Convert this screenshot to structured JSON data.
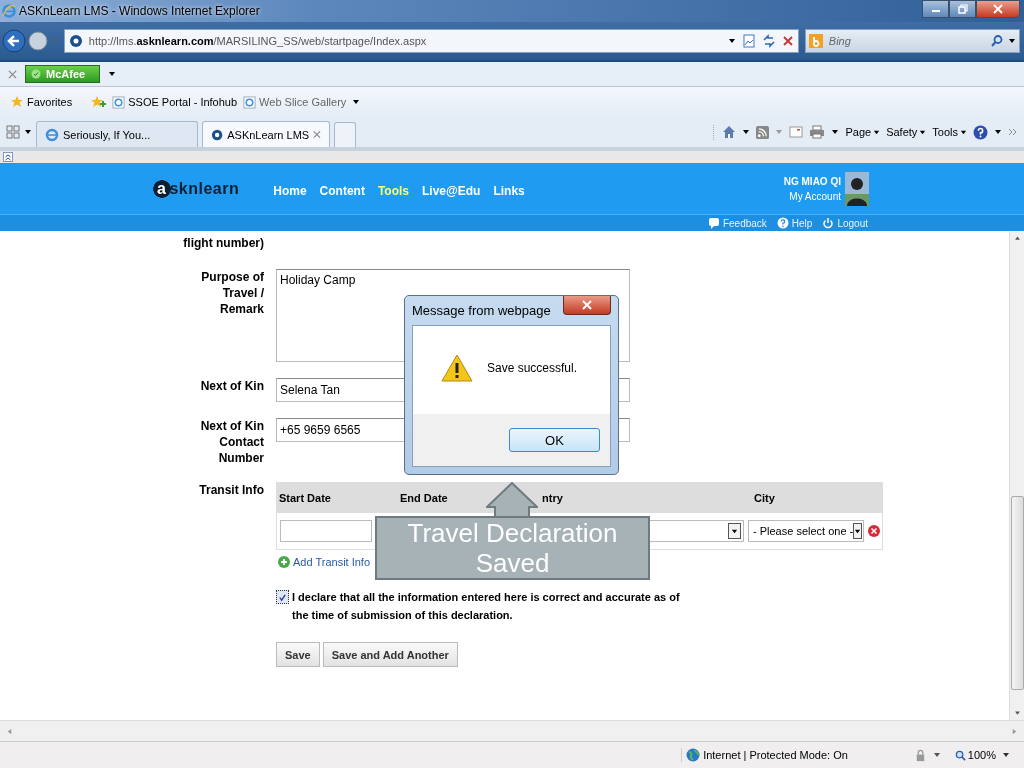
{
  "window": {
    "title": "ASKnLearn LMS - Windows Internet Explorer"
  },
  "address_bar": {
    "url": "http://lms.**asknlearn.com**/MARSILING_SS/web/startpage/Index.aspx"
  },
  "search": {
    "placeholder": "Bing"
  },
  "addon_bar": {
    "addon": "McAfee"
  },
  "favorites_bar": {
    "label": "Favorites",
    "links": [
      "SSOE Portal - Infohub",
      "Web Slice Gallery"
    ]
  },
  "tabs": [
    {
      "label": "Seriously, If You...",
      "selected": false
    },
    {
      "label": "ASKnLearn LMS",
      "selected": true
    }
  ],
  "command_bar": [
    "Page",
    "Safety",
    "Tools"
  ],
  "site": {
    "logo": "asknlearn",
    "nav": [
      {
        "label": "Home",
        "selected": false
      },
      {
        "label": "Content",
        "selected": false
      },
      {
        "label": "Tools",
        "selected": true
      },
      {
        "label": "Live@Edu",
        "selected": false
      },
      {
        "label": "Links",
        "selected": false
      }
    ],
    "user": "NG MIAO QI",
    "account": "My Account",
    "links": [
      "Feedback",
      "Help",
      "Logout"
    ]
  },
  "form": {
    "flight_label": "flight number)",
    "purpose": {
      "label": "Purpose of Travel / Remark",
      "value": "Holiday Camp"
    },
    "next_of_kin": {
      "label": "Next of Kin",
      "value": "Selena Tan"
    },
    "contact": {
      "label": "Next of Kin Contact Number",
      "value": "+65 9659 6565"
    },
    "transit": {
      "label": "Transit Info",
      "columns": [
        "Start Date",
        "End Date",
        "ntry",
        "City"
      ],
      "city_placeholder": "- Please select one -",
      "add_link": "Add Transit Info"
    },
    "declaration": {
      "checked": true,
      "text": "I declare that all the information entered here is correct and accurate as of the time of submission of this declaration."
    },
    "buttons": [
      "Save",
      "Save and Add Another"
    ]
  },
  "dialog": {
    "title": "Message from webpage",
    "message": "Save successful.",
    "button": "OK"
  },
  "callout": "Travel Declaration Saved",
  "status_bar": {
    "zone": "Internet | Protected Mode: On",
    "zoom": "100%"
  }
}
